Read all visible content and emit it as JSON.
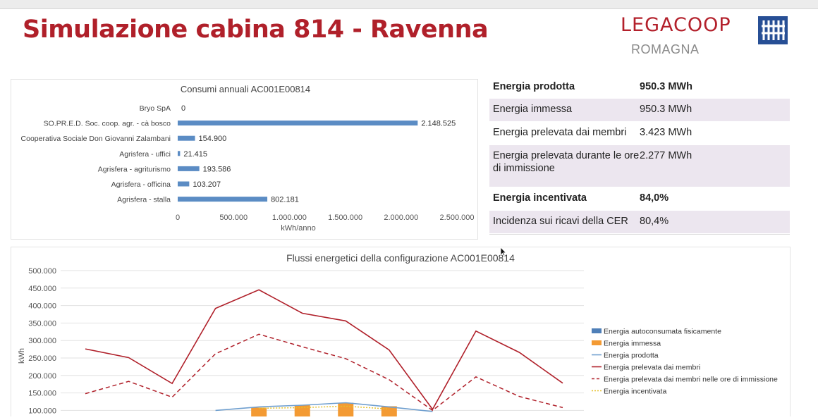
{
  "slide": {
    "title": "Simulazione cabina 814 - Ravenna",
    "logo_word": "LEGACOOP",
    "logo_sub": "ROMAGNA",
    "accent_color": "#b0202a",
    "logo_mark_color": "#274f95"
  },
  "stats": [
    {
      "label": "Energia prodotta",
      "value": "950.3 MWh",
      "bold": true,
      "shaded": false
    },
    {
      "label": "Energia immessa",
      "value": "950.3 MWh",
      "bold": false,
      "shaded": true
    },
    {
      "label": "Energia prelevata dai membri",
      "value": "3.423 MWh",
      "bold": false,
      "shaded": false
    },
    {
      "label": "Energia prelevata durante le ore di immissione",
      "value": "2.277 MWh",
      "bold": false,
      "shaded": true
    },
    {
      "label": "Energia incentivata",
      "value": "84,0%",
      "bold": true,
      "shaded": false
    },
    {
      "label": "Incidenza sui ricavi della CER",
      "value": "80,4%",
      "bold": false,
      "shaded": true
    }
  ],
  "chart_data": [
    {
      "type": "bar",
      "orientation": "horizontal",
      "title": "Consumi annuali AC001E00814",
      "xlabel": "kWh/anno",
      "ylabel": "",
      "categories": [
        "Bryo SpA",
        "SO.PR.E.D. Soc. coop. agr. - cà bosco",
        "Cooperativa Sociale Don Giovanni Zalambani",
        "Agrisfera - uffici",
        "Agrisfera - agriturismo",
        "Agrisfera - officina",
        "Agrisfera - stalla"
      ],
      "values": [
        0,
        2148525,
        154900,
        21415,
        193586,
        103207,
        802181
      ],
      "value_labels": [
        "0",
        "2.148.525",
        "154.900",
        "21.415",
        "193.586",
        "103.207",
        "802.181"
      ],
      "xlim": [
        0,
        2500000
      ],
      "xticks": [
        0,
        500000,
        1000000,
        1500000,
        2000000,
        2500000
      ],
      "xtick_labels": [
        "0",
        "500.000",
        "1.000.000",
        "1.500.000",
        "2.000.000",
        "2.500.000"
      ],
      "bar_color": "#5b8cc4",
      "grid": false
    },
    {
      "type": "line",
      "title": "Flussi energetici della configurazione AC001E00814",
      "xlabel": "",
      "ylabel": "kWh",
      "ylim": [
        100000,
        500000
      ],
      "yticks": [
        100000,
        150000,
        200000,
        250000,
        300000,
        350000,
        400000,
        450000,
        500000
      ],
      "ytick_labels": [
        "100.000",
        "150.000",
        "200.000",
        "250.000",
        "300.000",
        "350.000",
        "400.000",
        "450.000",
        "500.000"
      ],
      "grid": true,
      "legend_position": "right",
      "x": [
        1,
        2,
        3,
        4,
        5,
        6,
        7,
        8,
        9,
        10,
        11,
        12
      ],
      "series": [
        {
          "name": "Energia autoconsumata fisicamente",
          "kind": "bar",
          "color": "#4f7fb8",
          "values": [
            null,
            null,
            null,
            null,
            null,
            null,
            null,
            null,
            null,
            null,
            null,
            null
          ]
        },
        {
          "name": "Energia immessa",
          "kind": "bar",
          "color": "#f39a33",
          "values": [
            null,
            null,
            null,
            null,
            108000,
            115000,
            122000,
            112000,
            null,
            null,
            null,
            null
          ]
        },
        {
          "name": "Energia prodotta",
          "kind": "line",
          "color": "#6f9fcf",
          "dash": "solid",
          "values": [
            null,
            null,
            null,
            100000,
            110000,
            115000,
            122000,
            110000,
            97000,
            null,
            null,
            null
          ]
        },
        {
          "name": "Energia prelevata dai membri",
          "kind": "line",
          "color": "#b0202a",
          "dash": "solid",
          "values": [
            276000,
            251000,
            177000,
            392000,
            445000,
            378000,
            356000,
            273000,
            103000,
            327000,
            266000,
            178000
          ]
        },
        {
          "name": "Energia prelevata dai membri nelle ore di immissione",
          "kind": "line",
          "color": "#b0202a",
          "dash": "dashed",
          "values": [
            148000,
            183000,
            138000,
            262000,
            318000,
            282000,
            248000,
            188000,
            100000,
            196000,
            140000,
            108000
          ]
        },
        {
          "name": "Energia incentivata",
          "kind": "line",
          "color": "#e6c02a",
          "dash": "dotted",
          "values": [
            null,
            null,
            null,
            null,
            106000,
            108000,
            112000,
            104000,
            null,
            null,
            null,
            null
          ]
        }
      ]
    }
  ]
}
